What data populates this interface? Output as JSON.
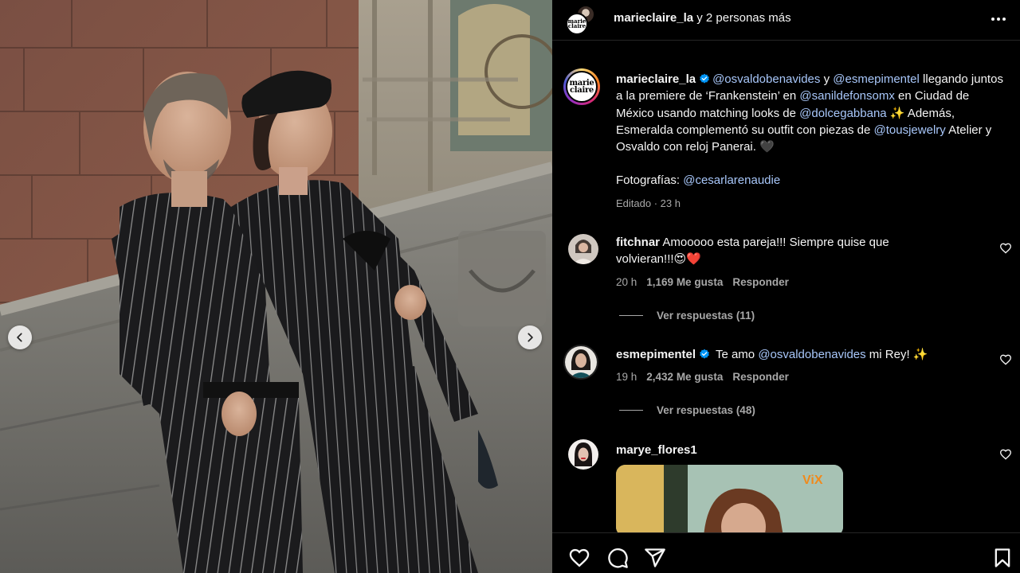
{
  "header": {
    "username": "marieclaire_la",
    "others_text": " y 2 personas más",
    "logo_text_line1": "marie",
    "logo_text_line2": "claire"
  },
  "caption": {
    "username": "marieclaire_la",
    "mention1": "@osvaldobenavides",
    "conj": " y ",
    "mention2": "@esmepimentel",
    "text1": " llegando juntos a la premiere de ‘Frankenstein’ en ",
    "mention3": "@sanildefonsomx",
    "text2": " en Ciudad de México usando matching looks de ",
    "mention4": "@dolcegabbana",
    "text3": " ✨ Además, Esmeralda complementó su outfit con piezas de ",
    "mention5": "@tousjewelry",
    "text4": " Atelier y Osvaldo con reloj Panerai. 🖤",
    "photos_label": "Fotografías: ",
    "mention6": "@cesarlarenaudie",
    "meta": "Editado · 23 h"
  },
  "comments": [
    {
      "username": "fitchnar",
      "text": "Amooooo esta pareja!!! Siempre quise que volvieran!!!😍❤️",
      "time": "20 h",
      "likes": "1,169 Me gusta",
      "reply": "Responder",
      "view_replies": "Ver respuestas (11)"
    },
    {
      "username": "esmepimentel",
      "text_pre": " Te amo ",
      "mention": "@osvaldobenavides",
      "text_post": " mi Rey! ✨",
      "time": "19 h",
      "likes": "2,432 Me gusta",
      "reply": "Responder",
      "view_replies": "Ver respuestas (48)"
    },
    {
      "username": "marye_flores1",
      "gif_badge": "ViX"
    }
  ],
  "icons": {
    "more": "more-options-icon",
    "like": "heart-icon",
    "comment": "comment-icon",
    "share": "share-icon",
    "save": "bookmark-icon",
    "prev": "chevron-left-icon",
    "next": "chevron-right-icon",
    "verified": "verified-badge-icon"
  },
  "colors": {
    "background": "#000000",
    "text": "#f5f5f5",
    "secondary": "#a8a8a8",
    "mention": "#a8c7fa",
    "verified": "#0095f6"
  }
}
